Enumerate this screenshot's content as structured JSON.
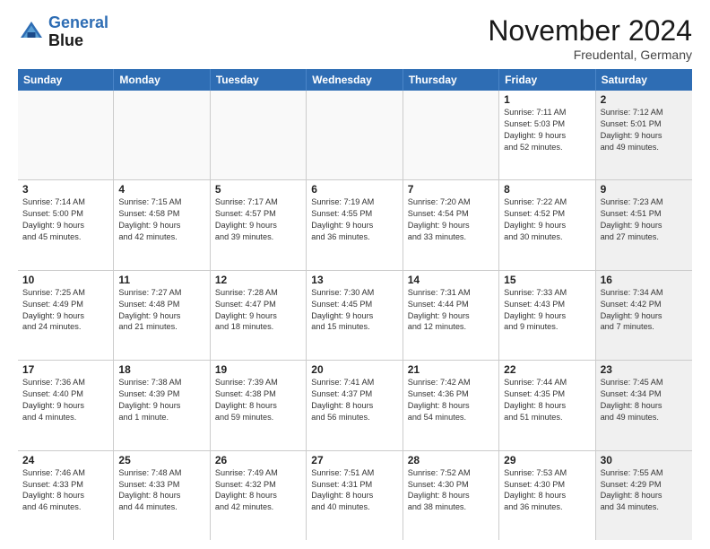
{
  "header": {
    "logo_line1": "General",
    "logo_line2": "Blue",
    "title": "November 2024",
    "location": "Freudental, Germany"
  },
  "weekdays": [
    "Sunday",
    "Monday",
    "Tuesday",
    "Wednesday",
    "Thursday",
    "Friday",
    "Saturday"
  ],
  "rows": [
    [
      {
        "day": "",
        "info": "",
        "shaded": false,
        "empty": true
      },
      {
        "day": "",
        "info": "",
        "shaded": false,
        "empty": true
      },
      {
        "day": "",
        "info": "",
        "shaded": false,
        "empty": true
      },
      {
        "day": "",
        "info": "",
        "shaded": false,
        "empty": true
      },
      {
        "day": "",
        "info": "",
        "shaded": false,
        "empty": true
      },
      {
        "day": "1",
        "info": "Sunrise: 7:11 AM\nSunset: 5:03 PM\nDaylight: 9 hours\nand 52 minutes.",
        "shaded": false,
        "empty": false
      },
      {
        "day": "2",
        "info": "Sunrise: 7:12 AM\nSunset: 5:01 PM\nDaylight: 9 hours\nand 49 minutes.",
        "shaded": true,
        "empty": false
      }
    ],
    [
      {
        "day": "3",
        "info": "Sunrise: 7:14 AM\nSunset: 5:00 PM\nDaylight: 9 hours\nand 45 minutes.",
        "shaded": false,
        "empty": false
      },
      {
        "day": "4",
        "info": "Sunrise: 7:15 AM\nSunset: 4:58 PM\nDaylight: 9 hours\nand 42 minutes.",
        "shaded": false,
        "empty": false
      },
      {
        "day": "5",
        "info": "Sunrise: 7:17 AM\nSunset: 4:57 PM\nDaylight: 9 hours\nand 39 minutes.",
        "shaded": false,
        "empty": false
      },
      {
        "day": "6",
        "info": "Sunrise: 7:19 AM\nSunset: 4:55 PM\nDaylight: 9 hours\nand 36 minutes.",
        "shaded": false,
        "empty": false
      },
      {
        "day": "7",
        "info": "Sunrise: 7:20 AM\nSunset: 4:54 PM\nDaylight: 9 hours\nand 33 minutes.",
        "shaded": false,
        "empty": false
      },
      {
        "day": "8",
        "info": "Sunrise: 7:22 AM\nSunset: 4:52 PM\nDaylight: 9 hours\nand 30 minutes.",
        "shaded": false,
        "empty": false
      },
      {
        "day": "9",
        "info": "Sunrise: 7:23 AM\nSunset: 4:51 PM\nDaylight: 9 hours\nand 27 minutes.",
        "shaded": true,
        "empty": false
      }
    ],
    [
      {
        "day": "10",
        "info": "Sunrise: 7:25 AM\nSunset: 4:49 PM\nDaylight: 9 hours\nand 24 minutes.",
        "shaded": false,
        "empty": false
      },
      {
        "day": "11",
        "info": "Sunrise: 7:27 AM\nSunset: 4:48 PM\nDaylight: 9 hours\nand 21 minutes.",
        "shaded": false,
        "empty": false
      },
      {
        "day": "12",
        "info": "Sunrise: 7:28 AM\nSunset: 4:47 PM\nDaylight: 9 hours\nand 18 minutes.",
        "shaded": false,
        "empty": false
      },
      {
        "day": "13",
        "info": "Sunrise: 7:30 AM\nSunset: 4:45 PM\nDaylight: 9 hours\nand 15 minutes.",
        "shaded": false,
        "empty": false
      },
      {
        "day": "14",
        "info": "Sunrise: 7:31 AM\nSunset: 4:44 PM\nDaylight: 9 hours\nand 12 minutes.",
        "shaded": false,
        "empty": false
      },
      {
        "day": "15",
        "info": "Sunrise: 7:33 AM\nSunset: 4:43 PM\nDaylight: 9 hours\nand 9 minutes.",
        "shaded": false,
        "empty": false
      },
      {
        "day": "16",
        "info": "Sunrise: 7:34 AM\nSunset: 4:42 PM\nDaylight: 9 hours\nand 7 minutes.",
        "shaded": true,
        "empty": false
      }
    ],
    [
      {
        "day": "17",
        "info": "Sunrise: 7:36 AM\nSunset: 4:40 PM\nDaylight: 9 hours\nand 4 minutes.",
        "shaded": false,
        "empty": false
      },
      {
        "day": "18",
        "info": "Sunrise: 7:38 AM\nSunset: 4:39 PM\nDaylight: 9 hours\nand 1 minute.",
        "shaded": false,
        "empty": false
      },
      {
        "day": "19",
        "info": "Sunrise: 7:39 AM\nSunset: 4:38 PM\nDaylight: 8 hours\nand 59 minutes.",
        "shaded": false,
        "empty": false
      },
      {
        "day": "20",
        "info": "Sunrise: 7:41 AM\nSunset: 4:37 PM\nDaylight: 8 hours\nand 56 minutes.",
        "shaded": false,
        "empty": false
      },
      {
        "day": "21",
        "info": "Sunrise: 7:42 AM\nSunset: 4:36 PM\nDaylight: 8 hours\nand 54 minutes.",
        "shaded": false,
        "empty": false
      },
      {
        "day": "22",
        "info": "Sunrise: 7:44 AM\nSunset: 4:35 PM\nDaylight: 8 hours\nand 51 minutes.",
        "shaded": false,
        "empty": false
      },
      {
        "day": "23",
        "info": "Sunrise: 7:45 AM\nSunset: 4:34 PM\nDaylight: 8 hours\nand 49 minutes.",
        "shaded": true,
        "empty": false
      }
    ],
    [
      {
        "day": "24",
        "info": "Sunrise: 7:46 AM\nSunset: 4:33 PM\nDaylight: 8 hours\nand 46 minutes.",
        "shaded": false,
        "empty": false
      },
      {
        "day": "25",
        "info": "Sunrise: 7:48 AM\nSunset: 4:33 PM\nDaylight: 8 hours\nand 44 minutes.",
        "shaded": false,
        "empty": false
      },
      {
        "day": "26",
        "info": "Sunrise: 7:49 AM\nSunset: 4:32 PM\nDaylight: 8 hours\nand 42 minutes.",
        "shaded": false,
        "empty": false
      },
      {
        "day": "27",
        "info": "Sunrise: 7:51 AM\nSunset: 4:31 PM\nDaylight: 8 hours\nand 40 minutes.",
        "shaded": false,
        "empty": false
      },
      {
        "day": "28",
        "info": "Sunrise: 7:52 AM\nSunset: 4:30 PM\nDaylight: 8 hours\nand 38 minutes.",
        "shaded": false,
        "empty": false
      },
      {
        "day": "29",
        "info": "Sunrise: 7:53 AM\nSunset: 4:30 PM\nDaylight: 8 hours\nand 36 minutes.",
        "shaded": false,
        "empty": false
      },
      {
        "day": "30",
        "info": "Sunrise: 7:55 AM\nSunset: 4:29 PM\nDaylight: 8 hours\nand 34 minutes.",
        "shaded": true,
        "empty": false
      }
    ]
  ]
}
